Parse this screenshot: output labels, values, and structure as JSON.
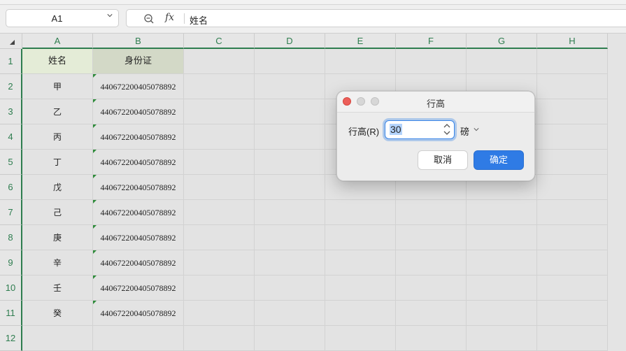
{
  "namebox": {
    "value": "A1"
  },
  "formula": {
    "content": "姓名",
    "fx_symbol": "fx"
  },
  "columns": [
    "A",
    "B",
    "C",
    "D",
    "E",
    "F",
    "G",
    "H"
  ],
  "rows": [
    "1",
    "2",
    "3",
    "4",
    "5",
    "6",
    "7",
    "8",
    "9",
    "10",
    "11",
    "12"
  ],
  "cells": {
    "A": [
      "姓名",
      "甲",
      "乙",
      "丙",
      "丁",
      "戊",
      "己",
      "庚",
      "辛",
      "壬",
      "癸"
    ],
    "B": [
      "身份证",
      "440672200405078892",
      "440672200405078892",
      "440672200405078892",
      "440672200405078892",
      "440672200405078892",
      "440672200405078892",
      "440672200405078892",
      "440672200405078892",
      "440672200405078892",
      "440672200405078892"
    ]
  },
  "dialog": {
    "title": "行高",
    "label": "行高(R)",
    "value": "30",
    "unit": "磅",
    "cancel": "取消",
    "ok": "确定"
  },
  "colors": {
    "accent": "#2e7d4f",
    "primary_button": "#2f7be5",
    "close_dot": "#ec5f5a"
  },
  "icons": [
    "zoom-icon",
    "chevron-down-icon",
    "spin-arrows-icon",
    "select-all-icon"
  ]
}
